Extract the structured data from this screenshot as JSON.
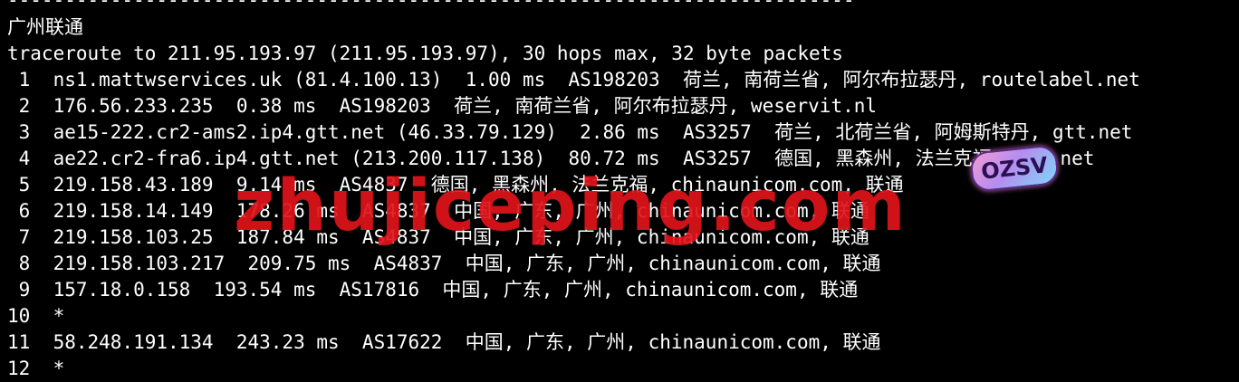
{
  "separator": "--------------------------------------------------------------------------",
  "title": "广州联通",
  "header": "traceroute to 211.95.193.97 (211.95.193.97), 30 hops max, 32 byte packets",
  "hops": [
    " 1  ns1.mattwservices.uk (81.4.100.13)  1.00 ms  AS198203  荷兰, 南荷兰省, 阿尔布拉瑟丹, routelabel.net",
    " 2  176.56.233.235  0.38 ms  AS198203  荷兰, 南荷兰省, 阿尔布拉瑟丹, weservit.nl",
    " 3  ae15-222.cr2-ams2.ip4.gtt.net (46.33.79.129)  2.86 ms  AS3257  荷兰, 北荷兰省, 阿姆斯特丹, gtt.net",
    " 4  ae22.cr2-fra6.ip4.gtt.net (213.200.117.138)  80.72 ms  AS3257  德国, 黑森州, 法兰克福, gtt.net",
    " 5  219.158.43.189  9.14 ms  AS4837  德国, 黑森州, 法兰克福, chinaunicom.com, 联通",
    " 6  219.158.14.149  178.26 ms  AS4837  中国, 广东, 广州, chinaunicom.com, 联通",
    " 7  219.158.103.25  187.84 ms  AS4837  中国, 广东, 广州, chinaunicom.com, 联通",
    " 8  219.158.103.217  209.75 ms  AS4837  中国, 广东, 广州, chinaunicom.com, 联通",
    " 9  157.18.0.158  193.54 ms  AS17816  中国, 广东, 广州, chinaunicom.com, 联通",
    "10  *",
    "11  58.248.191.134  243.23 ms  AS17622  中国, 广东, 广州, chinaunicom.com, 联通",
    "12  *"
  ],
  "watermark": "zhujiceping.com",
  "badge": "OZSV",
  "colors": {
    "background": "#000000",
    "text": "#ffffff",
    "watermark": "#e0141b"
  }
}
